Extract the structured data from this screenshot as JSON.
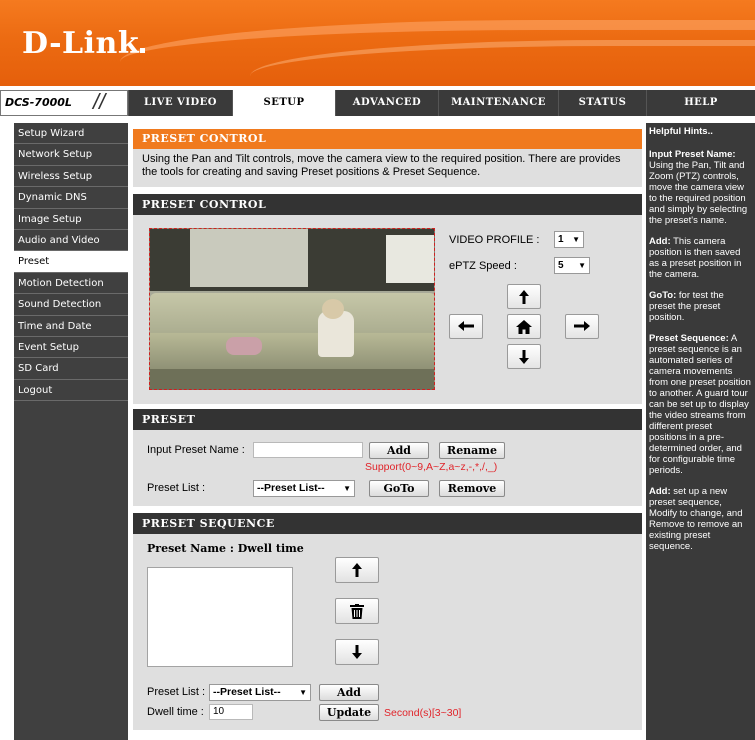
{
  "brand": {
    "logo": "D-Link"
  },
  "nav": {
    "model": "DCS-7000L",
    "slashes": "//",
    "tabs": [
      {
        "label": "LIVE VIDEO"
      },
      {
        "label": "SETUP"
      },
      {
        "label": "ADVANCED"
      },
      {
        "label": "MAINTENANCE"
      },
      {
        "label": "STATUS"
      },
      {
        "label": "HELP"
      }
    ]
  },
  "sidebar": {
    "items": [
      {
        "label": "Setup Wizard"
      },
      {
        "label": "Network Setup"
      },
      {
        "label": "Wireless Setup"
      },
      {
        "label": "Dynamic DNS"
      },
      {
        "label": "Image Setup"
      },
      {
        "label": "Audio and Video"
      },
      {
        "label": "Preset"
      },
      {
        "label": "Motion Detection"
      },
      {
        "label": "Sound Detection"
      },
      {
        "label": "Time and Date"
      },
      {
        "label": "Event Setup"
      },
      {
        "label": "SD Card"
      },
      {
        "label": "Logout"
      }
    ]
  },
  "intro": {
    "title": "PRESET CONTROL",
    "text": "Using the Pan and Tilt controls, move the camera view to the required position. There are provides the tools for creating and saving Preset positions & Preset Sequence."
  },
  "preset_control": {
    "title": "PRESET CONTROL",
    "video_profile_label": "VIDEO PROFILE :",
    "video_profile_value": "1",
    "eptz_speed_label": "ePTZ Speed :",
    "eptz_speed_value": "5"
  },
  "preset": {
    "title": "PRESET",
    "input_label": "Input Preset Name :",
    "input_value": "",
    "add": "Add",
    "rename": "Rename",
    "support_note": "Support(0~9,A~Z,a~z,-,*,/,_)",
    "list_label": "Preset List :",
    "list_value": "--Preset List--",
    "goto": "GoTo",
    "remove": "Remove"
  },
  "sequence": {
    "title": "PRESET SEQUENCE",
    "subtitle": "Preset Name : Dwell time",
    "list_label": "Preset List :",
    "list_value": "--Preset List--",
    "add": "Add",
    "dwell_label": "Dwell time :",
    "dwell_value": "10",
    "update": "Update",
    "dwell_note": "Second(s)[3~30]"
  },
  "help": {
    "title": "Helpful Hints..",
    "items": [
      {
        "head": "Input Preset Name:",
        "body": "Using the Pan, Tilt and Zoom (PTZ) controls, move the camera view to the required position and simply by selecting the preset's name."
      },
      {
        "head": "Add:",
        "body": "This camera position is then saved as a preset position in the camera."
      },
      {
        "head": "GoTo:",
        "body": "for test the preset the preset position."
      },
      {
        "head": "Preset Sequence:",
        "body": "A preset sequence is an automated series of camera movements from one preset position to another. A guard tour can be set up to display the video streams from different preset positions in a pre-determined order, and for configurable time periods."
      },
      {
        "head": "Add:",
        "body": "set up a new preset sequence, Modify to change, and Remove to remove an existing preset sequence."
      }
    ]
  }
}
